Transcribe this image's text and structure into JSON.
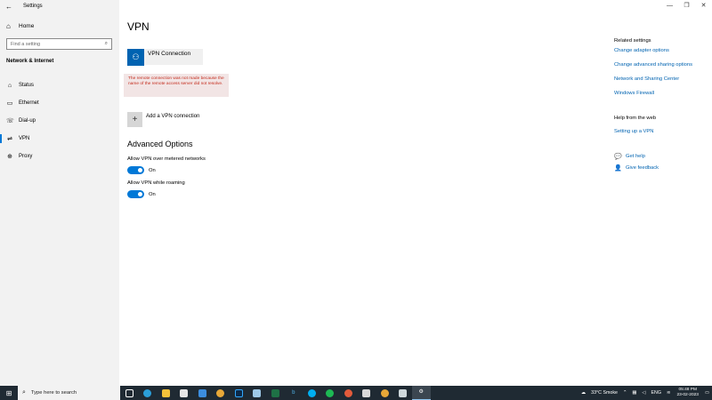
{
  "window": {
    "title": "Settings",
    "back_icon": "back-arrow-icon",
    "controls": {
      "minimize": "—",
      "restore": "❐",
      "close": "✕"
    }
  },
  "sidebar": {
    "home": {
      "icon": "home-icon",
      "label": "Home"
    },
    "search": {
      "placeholder": "Find a setting",
      "icon": "search-icon"
    },
    "section_title": "Network & Internet",
    "items": [
      {
        "icon": "status-icon",
        "label": "Status",
        "active": false
      },
      {
        "icon": "ethernet-icon",
        "label": "Ethernet",
        "active": false
      },
      {
        "icon": "dialup-icon",
        "label": "Dial-up",
        "active": false
      },
      {
        "icon": "vpn-icon",
        "label": "VPN",
        "active": true
      },
      {
        "icon": "proxy-icon",
        "label": "Proxy",
        "active": false
      }
    ]
  },
  "main": {
    "title": "VPN",
    "connection": {
      "name": "VPN Connection",
      "icon": "vpn-connection-icon"
    },
    "error": "The remote connection was not made because the name of the remote access server did not resolve.",
    "add_label": "Add a VPN connection",
    "advanced_title": "Advanced Options",
    "options": [
      {
        "label": "Allow VPN over metered networks",
        "state": "On"
      },
      {
        "label": "Allow VPN while roaming",
        "state": "On"
      }
    ]
  },
  "right": {
    "related_heading": "Related settings",
    "related_links": [
      "Change adapter options",
      "Change advanced sharing options",
      "Network and Sharing Center",
      "Windows Firewall"
    ],
    "help_heading": "Help from the web",
    "help_link": "Setting up a VPN",
    "get_help": "Get help",
    "feedback": "Give feedback"
  },
  "taskbar": {
    "search_placeholder": "Type here to search",
    "weather": "33°C  Smoke",
    "lang": "ENG",
    "time": "05:48 PM",
    "date": "23-02-2023",
    "accent": "#0078d7"
  }
}
